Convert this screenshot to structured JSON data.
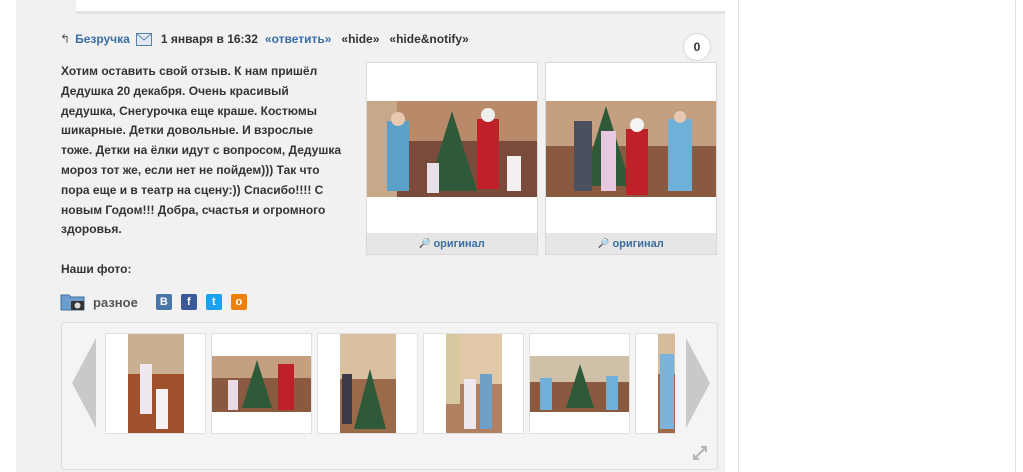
{
  "comment": {
    "reply_arrow": "↰",
    "author": "Безручка",
    "date": "1 января в 16:32",
    "reply_link": "«ответить»",
    "hide_link": "«hide»",
    "hide_notify_link": "«hide&notify»",
    "vote_count": "0",
    "text_lines": [
      "Хотим оставить свой отзыв. К нам пришёл",
      "Дедушка 20 декабря. Очень красивый",
      "дедушка, Снегурочка еще краше. Костюмы",
      "шикарные. Детки довольные. И взрослые",
      "тоже. Детки на ёлки идут с вопросом, Дедушка",
      "мороз тот же, если нет не пойдем))) Так что",
      "пора еще и в театр на сцену:)) Спасибо!!!! С",
      "новым Годом!!! Добра, счастья и огромного",
      "здоровья."
    ]
  },
  "photos": [
    {
      "original_label": "оригинал"
    },
    {
      "original_label": "оригинал"
    }
  ],
  "our_photos_label": "Наши фото:",
  "album": {
    "name": "разное",
    "icon": "folder-camera-icon",
    "social": [
      {
        "name": "vk-icon",
        "glyph": "B",
        "color": "#4a76a8"
      },
      {
        "name": "facebook-icon",
        "glyph": "f",
        "color": "#3b5998"
      },
      {
        "name": "twitter-icon",
        "glyph": "t",
        "color": "#1da1f2"
      },
      {
        "name": "odnoklassniki-icon",
        "glyph": "o",
        "color": "#ee8208"
      }
    ]
  },
  "colors": {
    "link": "#3a6ea5",
    "text": "#333333",
    "panel_bg": "#f1f1f1"
  }
}
